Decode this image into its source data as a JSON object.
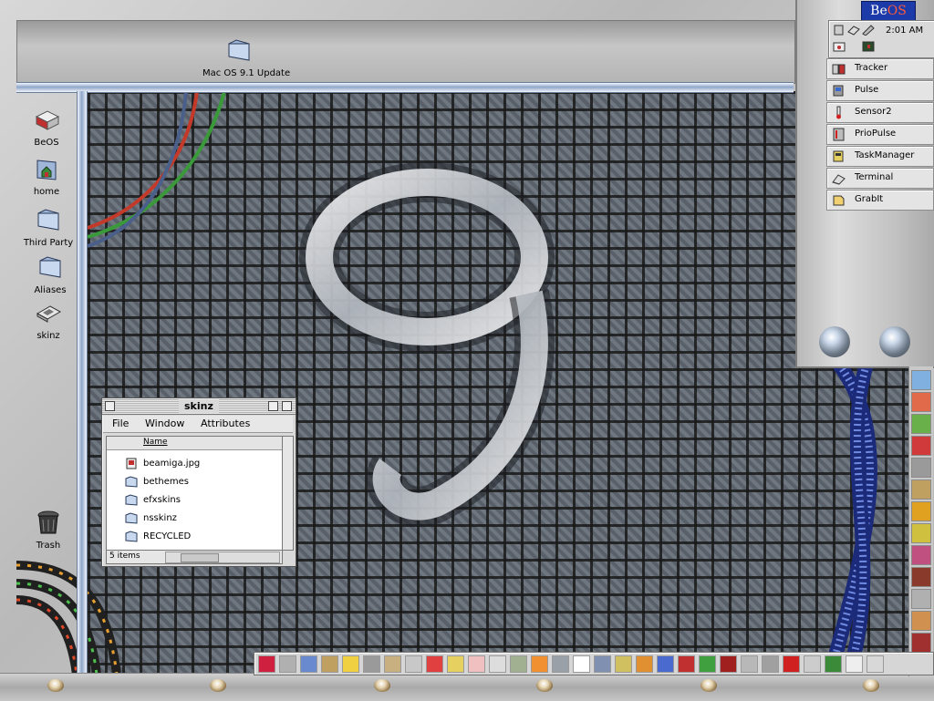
{
  "desktop": {
    "top_icon": {
      "label": "Mac OS 9.1 Update",
      "icon": "folder-icon"
    },
    "icons": [
      {
        "label": "BeOS",
        "icon": "disk-icon"
      },
      {
        "label": "home",
        "icon": "home-folder-icon"
      },
      {
        "label": "Third Party",
        "icon": "folder-icon"
      },
      {
        "label": "Aliases",
        "icon": "folder-icon"
      },
      {
        "label": "skinz",
        "icon": "floppy-icon"
      },
      {
        "label": "Trash",
        "icon": "trash-icon"
      }
    ]
  },
  "deskbar": {
    "logo_be": "Be",
    "logo_os": "OS",
    "clock": "2:01 AM",
    "apps": [
      {
        "label": "Tracker",
        "icon": "tracker-icon"
      },
      {
        "label": "Pulse",
        "icon": "pulse-icon"
      },
      {
        "label": "Sensor2",
        "icon": "thermometer-icon"
      },
      {
        "label": "PrioPulse",
        "icon": "priopulse-icon"
      },
      {
        "label": "TaskManager",
        "icon": "taskmanager-icon"
      },
      {
        "label": "Terminal",
        "icon": "terminal-icon"
      },
      {
        "label": "GrabIt",
        "icon": "grabit-icon"
      }
    ]
  },
  "window": {
    "title": "skinz",
    "menus": [
      "File",
      "Window",
      "Attributes"
    ],
    "column_header": "Name",
    "files": [
      {
        "name": "beamiga.jpg",
        "icon": "image-file-icon"
      },
      {
        "name": "bethemes",
        "icon": "folder-icon"
      },
      {
        "name": "efxskins",
        "icon": "folder-icon"
      },
      {
        "name": "nsskinz",
        "icon": "folder-icon"
      },
      {
        "name": "RECYCLED",
        "icon": "folder-icon"
      }
    ],
    "status": "5 items"
  },
  "colors": {
    "be_logo_bg": "#1d3ba8",
    "os_red": "#ff5a3a",
    "rail_blue": "#8fa6c8"
  }
}
